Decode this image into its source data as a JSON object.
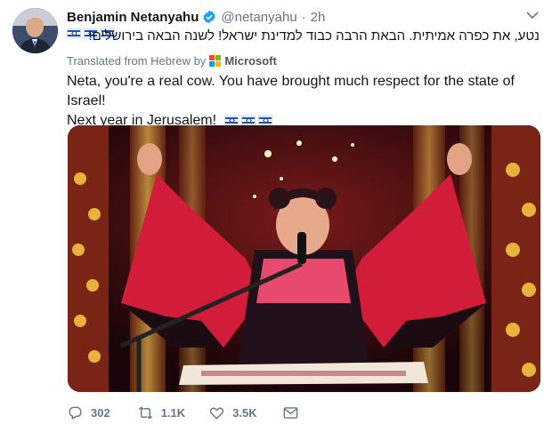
{
  "author": {
    "name": "Benjamin Netanyahu",
    "handle": "@netanyahu",
    "time": "2h",
    "verified": true
  },
  "hebrew_text": "נטע, את כפרה אמיתית. הבאת הרבה כבוד למדינת ישראל! לשנה הבאה בירושלים!",
  "translated_label": "Translated from Hebrew by",
  "translator": "Microsoft",
  "body": {
    "line1": "Neta, you're a real cow. You have brought much respect for the state of Israel!",
    "line2": "Next year in Jerusalem!"
  },
  "actions": {
    "replies": "302",
    "retweets": "1.1K",
    "likes": "3.5K"
  },
  "icons": [
    "verified-badge-icon",
    "chevron-down-icon",
    "reply-icon",
    "retweet-icon",
    "like-icon",
    "message-icon",
    "israel-flag-icon",
    "microsoft-logo-icon"
  ],
  "colors": {
    "verified": "#1da1f2",
    "muted": "#657786",
    "text": "#14171a"
  }
}
